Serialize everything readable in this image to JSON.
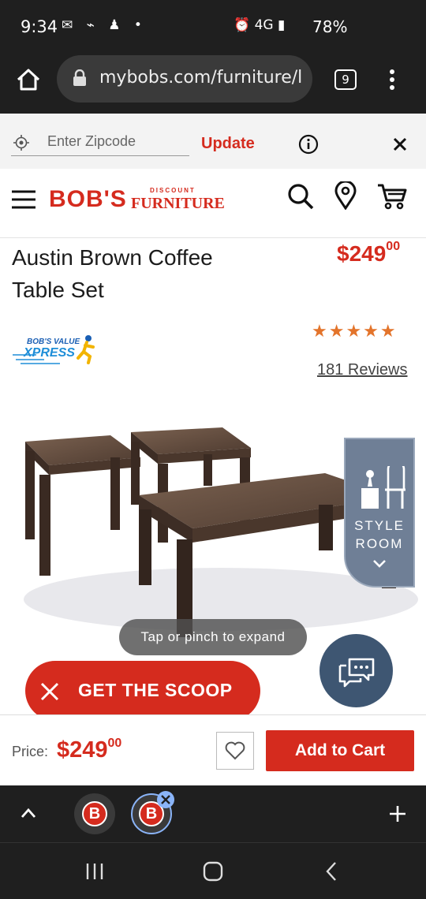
{
  "status_bar": {
    "time": "9:34",
    "left_icons": "✉ ⌁ ♟ •",
    "right_icons": "⏰ 4G ▮",
    "battery": "78%"
  },
  "browser": {
    "url": "mybobs.com/furniture/l",
    "tab_count": "9"
  },
  "zip": {
    "placeholder": "Enter Zipcode",
    "update_label": "Update"
  },
  "header": {
    "logo_main": "BOB'S",
    "logo_sub_small": "DISCOUNT",
    "logo_sub_large": "FURNITURE"
  },
  "product": {
    "title": "Austin Brown Coffee Table Set",
    "price_dollars": "$249",
    "price_cents": "00",
    "badge_line1": "BOB'S VALUE",
    "badge_line2": "XPRESS",
    "stars": "★★★★★",
    "rating": 5,
    "reviews_label": "181 Reviews"
  },
  "image_overlay": {
    "style_room_line1": "STYLE",
    "style_room_line2": "ROOM",
    "tap_hint": "Tap or pinch to expand"
  },
  "promo": {
    "scoop_label": "GET THE SCOOP"
  },
  "sticky": {
    "price_label": "Price:",
    "price_dollars": "$249",
    "price_cents": "00",
    "add_to_cart": "Add to Cart"
  },
  "tab_strip": {
    "favicon_letter": "B"
  },
  "colors": {
    "brand_red": "#d52b1e",
    "star_orange": "#e3742b",
    "chat_blue": "#3e5672",
    "style_room": "#6f7f96"
  }
}
